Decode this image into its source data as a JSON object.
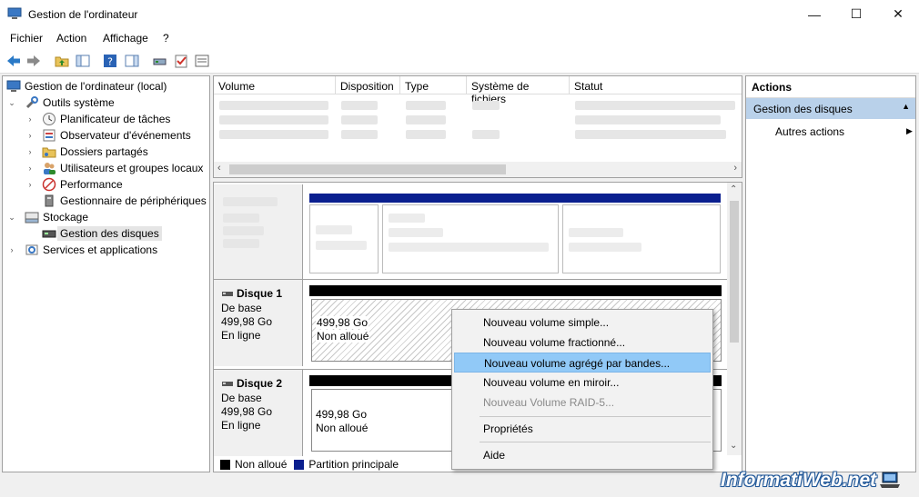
{
  "window": {
    "title": "Gestion de l'ordinateur",
    "minimize": "—",
    "maximize": "☐",
    "close": "✕"
  },
  "menu": [
    "Fichier",
    "Action",
    "Affichage",
    "?"
  ],
  "tree": {
    "root": "Gestion de l'ordinateur (local)",
    "outils": "Outils système",
    "planificateur": "Planificateur de tâches",
    "observateur": "Observateur d'événements",
    "dossiers": "Dossiers partagés",
    "utilisateurs": "Utilisateurs et groupes locaux",
    "performance": "Performance",
    "peripheriques": "Gestionnaire de périphériques",
    "stockage": "Stockage",
    "gestion_disques": "Gestion des disques",
    "services": "Services et applications"
  },
  "volume_table": {
    "headers": [
      "Volume",
      "Disposition",
      "Type",
      "Système de fichiers",
      "Statut"
    ]
  },
  "disks": [
    {
      "name": "Disque 1",
      "type": "De base",
      "size": "499,98 Go",
      "status": "En ligne",
      "part_size": "499,98 Go",
      "part_status": "Non alloué"
    },
    {
      "name": "Disque 2",
      "type": "De base",
      "size": "499,98 Go",
      "status": "En ligne",
      "part_size": "499,98 Go",
      "part_status": "Non alloué"
    }
  ],
  "legend": {
    "unallocated": "Non alloué",
    "primary": "Partition principale"
  },
  "actions": {
    "header": "Actions",
    "section": "Gestion des disques",
    "more": "Autres actions"
  },
  "context_menu": {
    "simple": "Nouveau volume simple...",
    "spanned": "Nouveau volume fractionné...",
    "striped": "Nouveau volume agrégé par bandes...",
    "mirror": "Nouveau volume en miroir...",
    "raid5": "Nouveau Volume RAID-5...",
    "properties": "Propriétés",
    "help": "Aide"
  },
  "watermark": "InformatiWeb.net",
  "colors": {
    "unallocated": "#000000",
    "primary": "#0a1f8f",
    "highlight": "#91c9f7",
    "action_section": "#b9d1ea"
  }
}
